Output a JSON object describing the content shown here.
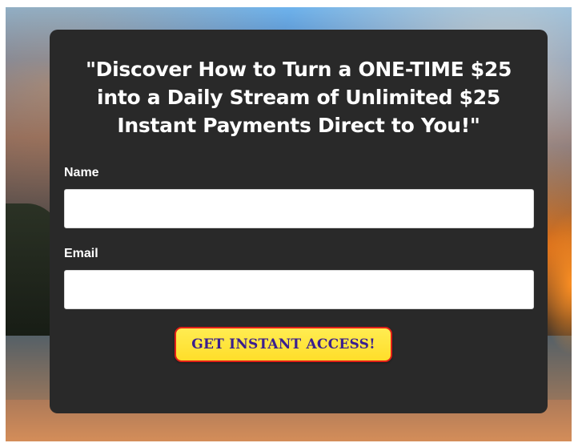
{
  "optin": {
    "headline": "\"Discover How to Turn a ONE-TIME $25 into a Daily Stream of Unlimited $25 Instant Payments Direct to You!\"",
    "fields": {
      "name": {
        "label": "Name",
        "value": "",
        "placeholder": ""
      },
      "email": {
        "label": "Email",
        "value": "",
        "placeholder": ""
      }
    },
    "cta_label": "GET INSTANT ACCESS!"
  },
  "colors": {
    "card_background": "#292929",
    "cta_background": "#ffde2a",
    "cta_border": "#e02017",
    "cta_text": "#3a1f8f"
  }
}
